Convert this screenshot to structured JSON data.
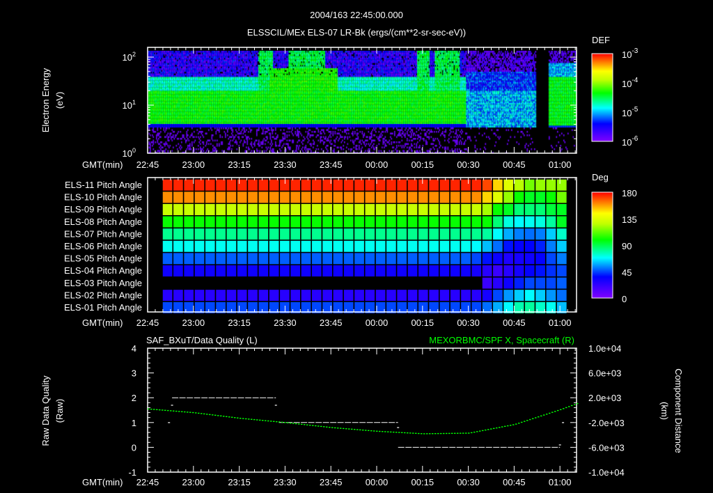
{
  "title": {
    "line1": "2004/163 22:45:00.000",
    "line2": "ELSSCIL/MEx ELS-07 LR-Bk  (ergs/(cm**2-sr-sec-eV))"
  },
  "colors": {
    "background": "#000000",
    "axes": "#ffffff",
    "right_series": "#00ff00"
  },
  "chart_data": [
    {
      "type": "heatmap",
      "id": "electron-spectrogram",
      "ylabel": [
        "Electron Energy",
        "(eV)"
      ],
      "yscale": "log",
      "ylim": [
        1,
        155
      ],
      "yticks": [
        {
          "base": "10",
          "exp": "2",
          "value": 100
        },
        {
          "base": "10",
          "exp": "1",
          "value": 10
        },
        {
          "base": "10",
          "exp": "0",
          "value": 1
        }
      ],
      "xlabel": "GMT(min)",
      "xticks": [
        "22:45",
        "23:00",
        "23:15",
        "23:30",
        "23:45",
        "00:00",
        "00:15",
        "00:30",
        "00:45",
        "01:00"
      ],
      "xlim": [
        "22:45",
        "01:05"
      ],
      "colorbar": {
        "title": "DEF",
        "scale": "log",
        "range": [
          1e-06,
          0.001
        ],
        "ticks": [
          {
            "base": "10",
            "exp": "-3",
            "value": -3
          },
          {
            "base": "10",
            "exp": "-4",
            "value": -4
          },
          {
            "base": "10",
            "exp": "-5",
            "value": -5
          },
          {
            "base": "10",
            "exp": "-6",
            "value": -6
          }
        ]
      },
      "features": [
        {
          "from": "22:45",
          "to": "00:30",
          "energy_eV": [
            3.6,
            20
          ],
          "log_def": -4.35
        },
        {
          "from": "22:45",
          "to": "00:30",
          "energy_eV": [
            20,
            40
          ],
          "log_def": -4.7
        },
        {
          "from": "22:45",
          "to": "00:30",
          "energy_eV": [
            40,
            145
          ],
          "log_def": -5.6
        },
        {
          "from": "00:30",
          "to": "00:52",
          "energy_eV": [
            3.6,
            20
          ],
          "log_def": -5.0
        },
        {
          "from": "00:52",
          "to": "00:56",
          "energy_eV": [
            1,
            155
          ],
          "log_def": null
        },
        {
          "from": "00:56",
          "to": "01:05",
          "energy_eV": [
            3.6,
            40
          ],
          "log_def": -4.4
        }
      ]
    },
    {
      "type": "heatmap",
      "id": "pitch-angle",
      "xlabel": "GMT(min)",
      "xlim": [
        "22:45",
        "01:05"
      ],
      "time_start": "22:50",
      "bin_minutes": 3.5,
      "rows": [
        {
          "label": "ELS-11 Pitch Angle",
          "base": 175,
          "tail": [
            175,
            175,
            170,
            150,
            135,
            125,
            115,
            120,
            120,
            120
          ]
        },
        {
          "label": "ELS-10 Pitch Angle",
          "base": 160,
          "tail": [
            160,
            160,
            150,
            135,
            120,
            100,
            95,
            95,
            100,
            115
          ]
        },
        {
          "label": "ELS-09 Pitch Angle",
          "base": 128,
          "tail": [
            128,
            128,
            122,
            100,
            95,
            85,
            85,
            85,
            92,
            95
          ]
        },
        {
          "label": "ELS-08 Pitch Angle",
          "base": 100,
          "tail": [
            100,
            100,
            100,
            85,
            72,
            68,
            70,
            72,
            80,
            95
          ]
        },
        {
          "label": "ELS-07 Pitch Angle",
          "base": 82,
          "tail": [
            82,
            82,
            80,
            68,
            58,
            52,
            50,
            52,
            62,
            75
          ]
        },
        {
          "label": "ELS-06 Pitch Angle",
          "base": 70,
          "tail": [
            70,
            68,
            60,
            50,
            38,
            35,
            36,
            40,
            52,
            62
          ]
        },
        {
          "label": "ELS-05 Pitch Angle",
          "base": 48,
          "tail": [
            48,
            45,
            38,
            33,
            28,
            30,
            32,
            35,
            45,
            52
          ]
        },
        {
          "label": "ELS-04 Pitch Angle",
          "base": 32,
          "tail": [
            32,
            30,
            25,
            20,
            25,
            30,
            35,
            38,
            42,
            45
          ]
        },
        {
          "label": "ELS-03 Pitch Angle",
          "base": null,
          "tail": [
            null,
            null,
            20,
            25,
            32,
            40,
            45,
            45,
            45,
            48
          ]
        },
        {
          "label": "ELS-02 Pitch Angle",
          "base": 25,
          "tail": [
            25,
            25,
            30,
            45,
            55,
            62,
            68,
            62,
            55,
            50
          ]
        },
        {
          "label": "ELS-01 Pitch Angle",
          "base": 45,
          "tail": [
            45,
            45,
            50,
            58,
            68,
            78,
            80,
            75,
            70,
            60
          ]
        }
      ],
      "colorbar": {
        "title": "Deg",
        "range": [
          0,
          180
        ],
        "ticks": [
          "180",
          "135",
          "90",
          "45",
          "0"
        ]
      }
    },
    {
      "type": "line",
      "id": "quality-and-position",
      "left_title": "SAF_BXuT/Data Quality (L)",
      "right_title": "MEXORBMC/SPF X, Spacecraft (R)",
      "ylabel_left": [
        "Raw Data Quality",
        "(Raw)"
      ],
      "ylabel_right": [
        "Component Distance",
        "(km)"
      ],
      "ylim_left": [
        -1,
        4
      ],
      "ylim_right": [
        -10000,
        10000
      ],
      "yticks_left": [
        "4",
        "3",
        "2",
        "1",
        "0",
        "-1"
      ],
      "yticks_right": [
        "1.0e+04",
        "6.0e+03",
        "2.0e+03",
        "-2.0e+03",
        "-6.0e+03",
        "-1.0e+04"
      ],
      "xlabel": "GMT(min)",
      "quality_segments": [
        {
          "from": "22:53",
          "to": "23:27",
          "value": 2
        },
        {
          "from": "23:28",
          "to": "00:07",
          "value": 1
        },
        {
          "from": "00:07",
          "to": "01:00",
          "value": 0
        }
      ],
      "quality_points": [
        {
          "t": "22:52",
          "value": 1
        },
        {
          "t": "22:53",
          "value": 1.7
        },
        {
          "t": "23:27",
          "value": 1.7
        },
        {
          "t": "00:07",
          "value": 0.8
        },
        {
          "t": "01:00",
          "value": 0.1
        },
        {
          "t": "01:01",
          "value": 1
        }
      ],
      "position_x": {
        "t": [
          "22:45",
          "23:00",
          "23:15",
          "23:30",
          "23:45",
          "00:00",
          "00:15",
          "00:30",
          "00:45",
          "01:00",
          "01:05"
        ],
        "km": [
          200,
          -400,
          -1300,
          -2000,
          -2800,
          -3400,
          -3800,
          -3700,
          -2300,
          100,
          1000
        ]
      }
    }
  ]
}
